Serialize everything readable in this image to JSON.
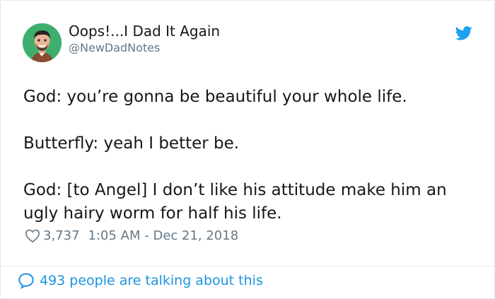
{
  "author": {
    "display_name": "Oops!...I Dad It Again",
    "handle": "@NewDadNotes",
    "avatar_icon": "man-portrait-avatar"
  },
  "platform_icon": "twitter-bird-icon",
  "tweet": {
    "lines": [
      "God: you’re gonna be beautiful your whole life.",
      "Butterfly: yeah I better be.",
      "God: [to Angel] I don’t like his attitude make him an ugly hairy worm for half his life."
    ]
  },
  "meta": {
    "likes": "3,737",
    "timestamp": "1:05 AM - Dec 21, 2018"
  },
  "footer": {
    "talking": "493 people are talking about this"
  },
  "colors": {
    "brand_blue": "#1da1f2",
    "link_blue": "#1b95e0",
    "text_dark": "#14171a",
    "text_gray": "#657786",
    "avatar_bg": "#3dae6b"
  }
}
